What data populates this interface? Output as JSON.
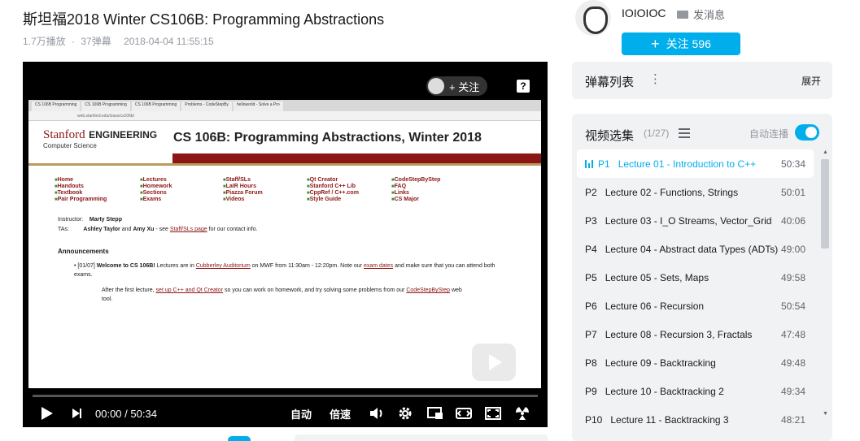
{
  "video": {
    "title": "斯坦福2018 Winter CS106B: Programming Abstractions",
    "views": "1.7万播放",
    "separator": "·",
    "danmaku_count": "37弹幕",
    "date": "2018-04-04 11:55:15"
  },
  "player": {
    "follow_label": "+ 关注",
    "help_label": "?",
    "time_current": "00:00",
    "time_sep": "/",
    "time_total": "50:34",
    "auto_label": "自动",
    "speed_label": "倍速",
    "progress": 0,
    "icons": [
      "play-icon",
      "next-icon",
      "volume-icon",
      "settings-icon",
      "pip-icon",
      "widescreen-icon",
      "fullscreen-icon",
      "radiation-icon",
      "help-icon"
    ]
  },
  "slide": {
    "tabs": [
      "CS 106B Programming",
      "CS 106B Programming",
      "CS 106B Programming",
      "Problems - CodeStepBy",
      "helloworld - Solve a Pro"
    ],
    "url": "web.stanford.edu/class/cs106b/",
    "logo_stanford": "Stanford",
    "logo_engineering": "ENGINEERING",
    "logo_cs": "Computer Science",
    "page_title": "CS 106B: Programming Abstractions, Winter 2018",
    "nav": [
      "Home",
      "Lectures",
      "Staff/SLs",
      "Qt Creator",
      "CodeStepByStep",
      "Handouts",
      "Homework",
      "LaIR Hours",
      "Stanford C++ Lib",
      "FAQ",
      "Textbook",
      "Sections",
      "Piazza Forum",
      "CppRef / C++.com",
      "Links",
      "Pair Programming",
      "Exams",
      "Videos",
      "Style Guide",
      "CS Major"
    ],
    "instructor_label": "Instructor:",
    "instructor": "Marty Stepp",
    "tas_label": "TAs:",
    "tas": "Ashley Taylor",
    "tas_and": "and",
    "tas2": "Amy Xu",
    "tas_see": "- see",
    "staff_link": "Staff/SLs page",
    "tas_rest": "for our contact info.",
    "announcements": "Announcements",
    "ann_date": "[01/07]",
    "ann_bold": "Welcome to CS 106B!",
    "ann_text1": "Lectures are in",
    "ann_link1": "Cubberley Auditorium",
    "ann_text2": "on MWF from 11:30am - 12:20pm. Note our",
    "ann_link2": "exam dates",
    "ann_text3": "and make sure that you can attend both exams.",
    "ann2_text1": "After the first lecture,",
    "ann2_link1": "set up C++ and Qt Creator",
    "ann2_text2": "so you can work on homework, and try solving some problems from our",
    "ann2_link2": "CodeStepByStep",
    "ann2_text3": "web tool."
  },
  "uploader": {
    "name": "IOIOIOC",
    "message_label": "发消息",
    "follow_label": "关注 596",
    "follow_plus": "+"
  },
  "danmaku_list": {
    "title": "弹幕列表",
    "more": "⋮",
    "expand": "展开"
  },
  "playlist": {
    "title": "视频选集",
    "count": "(1/27)",
    "autoplay_label": "自动连播",
    "autoplay_on": true,
    "items": [
      {
        "p": "P1",
        "name": "Lecture 01 - Introduction to C++",
        "duration": "50:34",
        "active": true
      },
      {
        "p": "P2",
        "name": "Lecture 02 - Functions, Strings",
        "duration": "50:01"
      },
      {
        "p": "P3",
        "name": "Lecture 03 - I_O Streams, Vector_Grid",
        "duration": "40:06"
      },
      {
        "p": "P4",
        "name": "Lecture 04 - Abstract data Types (ADTs)",
        "duration": "49:00"
      },
      {
        "p": "P5",
        "name": "Lecture 05 - Sets, Maps",
        "duration": "49:58"
      },
      {
        "p": "P6",
        "name": "Lecture 06 - Recursion",
        "duration": "50:54"
      },
      {
        "p": "P7",
        "name": "Lecture 08 - Recursion 3, Fractals",
        "duration": "47:48"
      },
      {
        "p": "P8",
        "name": "Lecture 09 - Backtracking",
        "duration": "49:48"
      },
      {
        "p": "P9",
        "name": "Lecture 10 - Backtracking 2",
        "duration": "49:34"
      },
      {
        "p": "P10",
        "name": "Lecture 11 - Backtracking 3",
        "duration": "48:21"
      }
    ]
  },
  "colors": {
    "accent": "#00aeec",
    "stanford_red": "#8c1515"
  }
}
